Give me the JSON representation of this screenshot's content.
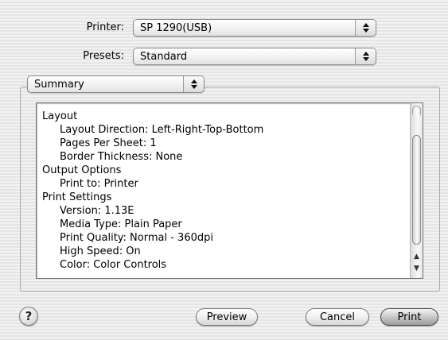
{
  "printer": {
    "label": "Printer:",
    "value": "SP 1290(USB)"
  },
  "presets": {
    "label": "Presets:",
    "value": "Standard"
  },
  "panel": {
    "value": "Summary"
  },
  "summary": {
    "lines": [
      {
        "text": "Layout",
        "indent": 0
      },
      {
        "text": "Layout Direction:  Left-Right-Top-Bottom",
        "indent": 1
      },
      {
        "text": "Pages Per Sheet:  1",
        "indent": 1
      },
      {
        "text": "Border Thickness:  None",
        "indent": 1
      },
      {
        "text": "Output Options",
        "indent": 0
      },
      {
        "text": "Print to:  Printer",
        "indent": 1
      },
      {
        "text": "Print Settings",
        "indent": 0
      },
      {
        "text": "Version:  1.13E",
        "indent": 1
      },
      {
        "text": "Media Type:  Plain Paper",
        "indent": 1
      },
      {
        "text": "Print Quality:  Normal - 360dpi",
        "indent": 1
      },
      {
        "text": "High Speed:  On",
        "indent": 1
      },
      {
        "text": "Color:  Color Controls",
        "indent": 1
      }
    ]
  },
  "buttons": {
    "help": "?",
    "preview": "Preview",
    "cancel": "Cancel",
    "print": "Print"
  },
  "icons": {
    "popup_arrows": "updown-arrows-icon",
    "scroll_up": "scroll-up-arrow-icon",
    "scroll_down": "scroll-down-arrow-icon"
  }
}
